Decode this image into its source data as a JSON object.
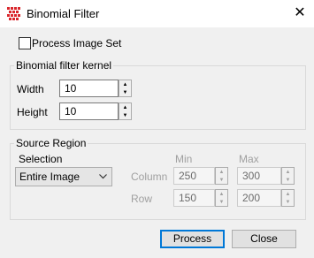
{
  "window": {
    "title": "Binomial Filter",
    "close_glyph": "✕",
    "icon": "app-dots-icon",
    "accent": "#0078d7"
  },
  "process_image_set": {
    "label": "Process Image Set",
    "checked": false
  },
  "kernel_group": {
    "title": "Binomial filter kernel",
    "width": {
      "label": "Width",
      "value": "10"
    },
    "height": {
      "label": "Height",
      "value": "10"
    }
  },
  "source_region": {
    "title": "Source Region",
    "selection_label": "Selection",
    "selection_value": "Entire Image",
    "min_header": "Min",
    "max_header": "Max",
    "column": {
      "label": "Column",
      "min": "250",
      "max": "300"
    },
    "row": {
      "label": "Row",
      "min": "150",
      "max": "200"
    }
  },
  "buttons": {
    "process": "Process",
    "close": "Close"
  }
}
